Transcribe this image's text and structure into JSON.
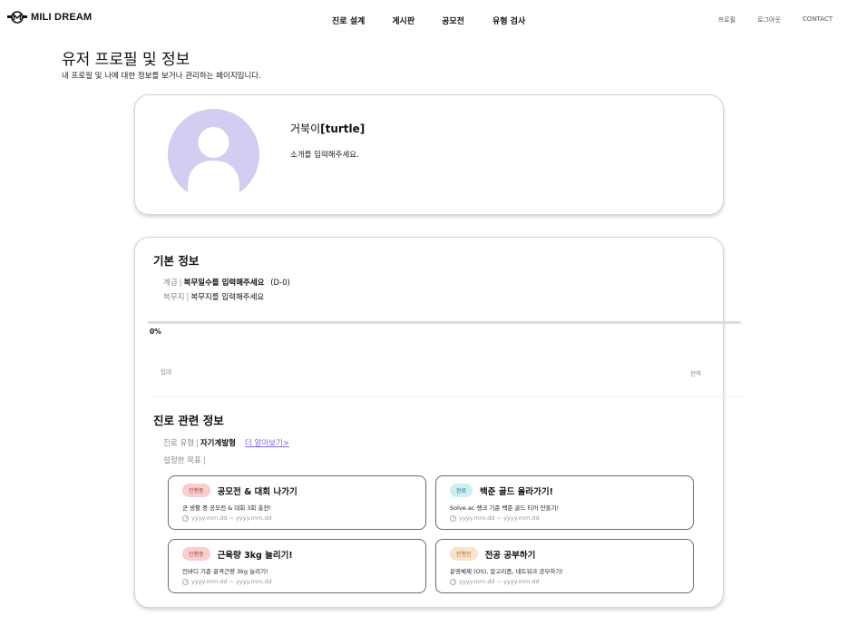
{
  "header": {
    "logo_text": "MILI DREAM",
    "nav": [
      "진로 설계",
      "게시판",
      "공모전",
      "유형 검사"
    ],
    "util": [
      "프로필",
      "로그아웃",
      "CONTACT"
    ]
  },
  "page": {
    "title": "유저 프로필 및 정보",
    "subtitle": "내 프로필 및 나에 대한 정보를 보거나 관리하는 페이지입니다."
  },
  "profile": {
    "name_prefix": "거북이",
    "name_id": "[turtle]",
    "intro": "소개를 입력해주세요."
  },
  "basic_info": {
    "title": "기본 정보",
    "rank_label": "계급",
    "rank_value": "복무일수를 입력해주세요",
    "dday": "(D-0)",
    "unit_label": "복무지",
    "unit_value": "복무지를 입력해주세요",
    "progress_text": "0%",
    "progress_value": 0,
    "start_label": "입대",
    "end_label": "전역"
  },
  "career_info": {
    "title": "진로 관련 정보",
    "type_label": "진로 유형",
    "type_value": "자기계발형",
    "more_link": "더 알아보기>",
    "goal_label": "설정한 목표"
  },
  "goals": [
    {
      "status": "진행중",
      "status_type": "progress",
      "title": "공모전 & 대회 나가기",
      "desc": "군 생활 중 공모전 & 대회 3회 출전!",
      "date": "yyyy.mm.dd ~ yyyy.mm.dd"
    },
    {
      "status": "완료",
      "status_type": "done",
      "title": "백준 골드 올라가기!",
      "desc": "Solve.ac 랭크 기준 백준 골드 티어 만들기!",
      "date": "yyyy.mm.dd ~ yyyy.mm.dd"
    },
    {
      "status": "진행중",
      "status_type": "progress",
      "title": "근육량 3kg 늘리기!",
      "desc": "인바디 기준 골격근량 3kg 늘리기!",
      "date": "yyyy.mm.dd ~ yyyy.mm.dd"
    },
    {
      "status": "진행전",
      "status_type": "todo",
      "title": "전공 공부하기",
      "desc": "운영체제 (OS), 알고리즘, 네트워크 공부하기!",
      "date": "yyyy.mm.dd ~ yyyy.mm.dd"
    }
  ],
  "colors": {
    "accent": "#7b6be0",
    "avatar_bg": "#d2cdf1",
    "badge_progress": "#f6cfcf",
    "badge_done": "#cdeef2",
    "badge_todo": "#f9e3c9"
  }
}
